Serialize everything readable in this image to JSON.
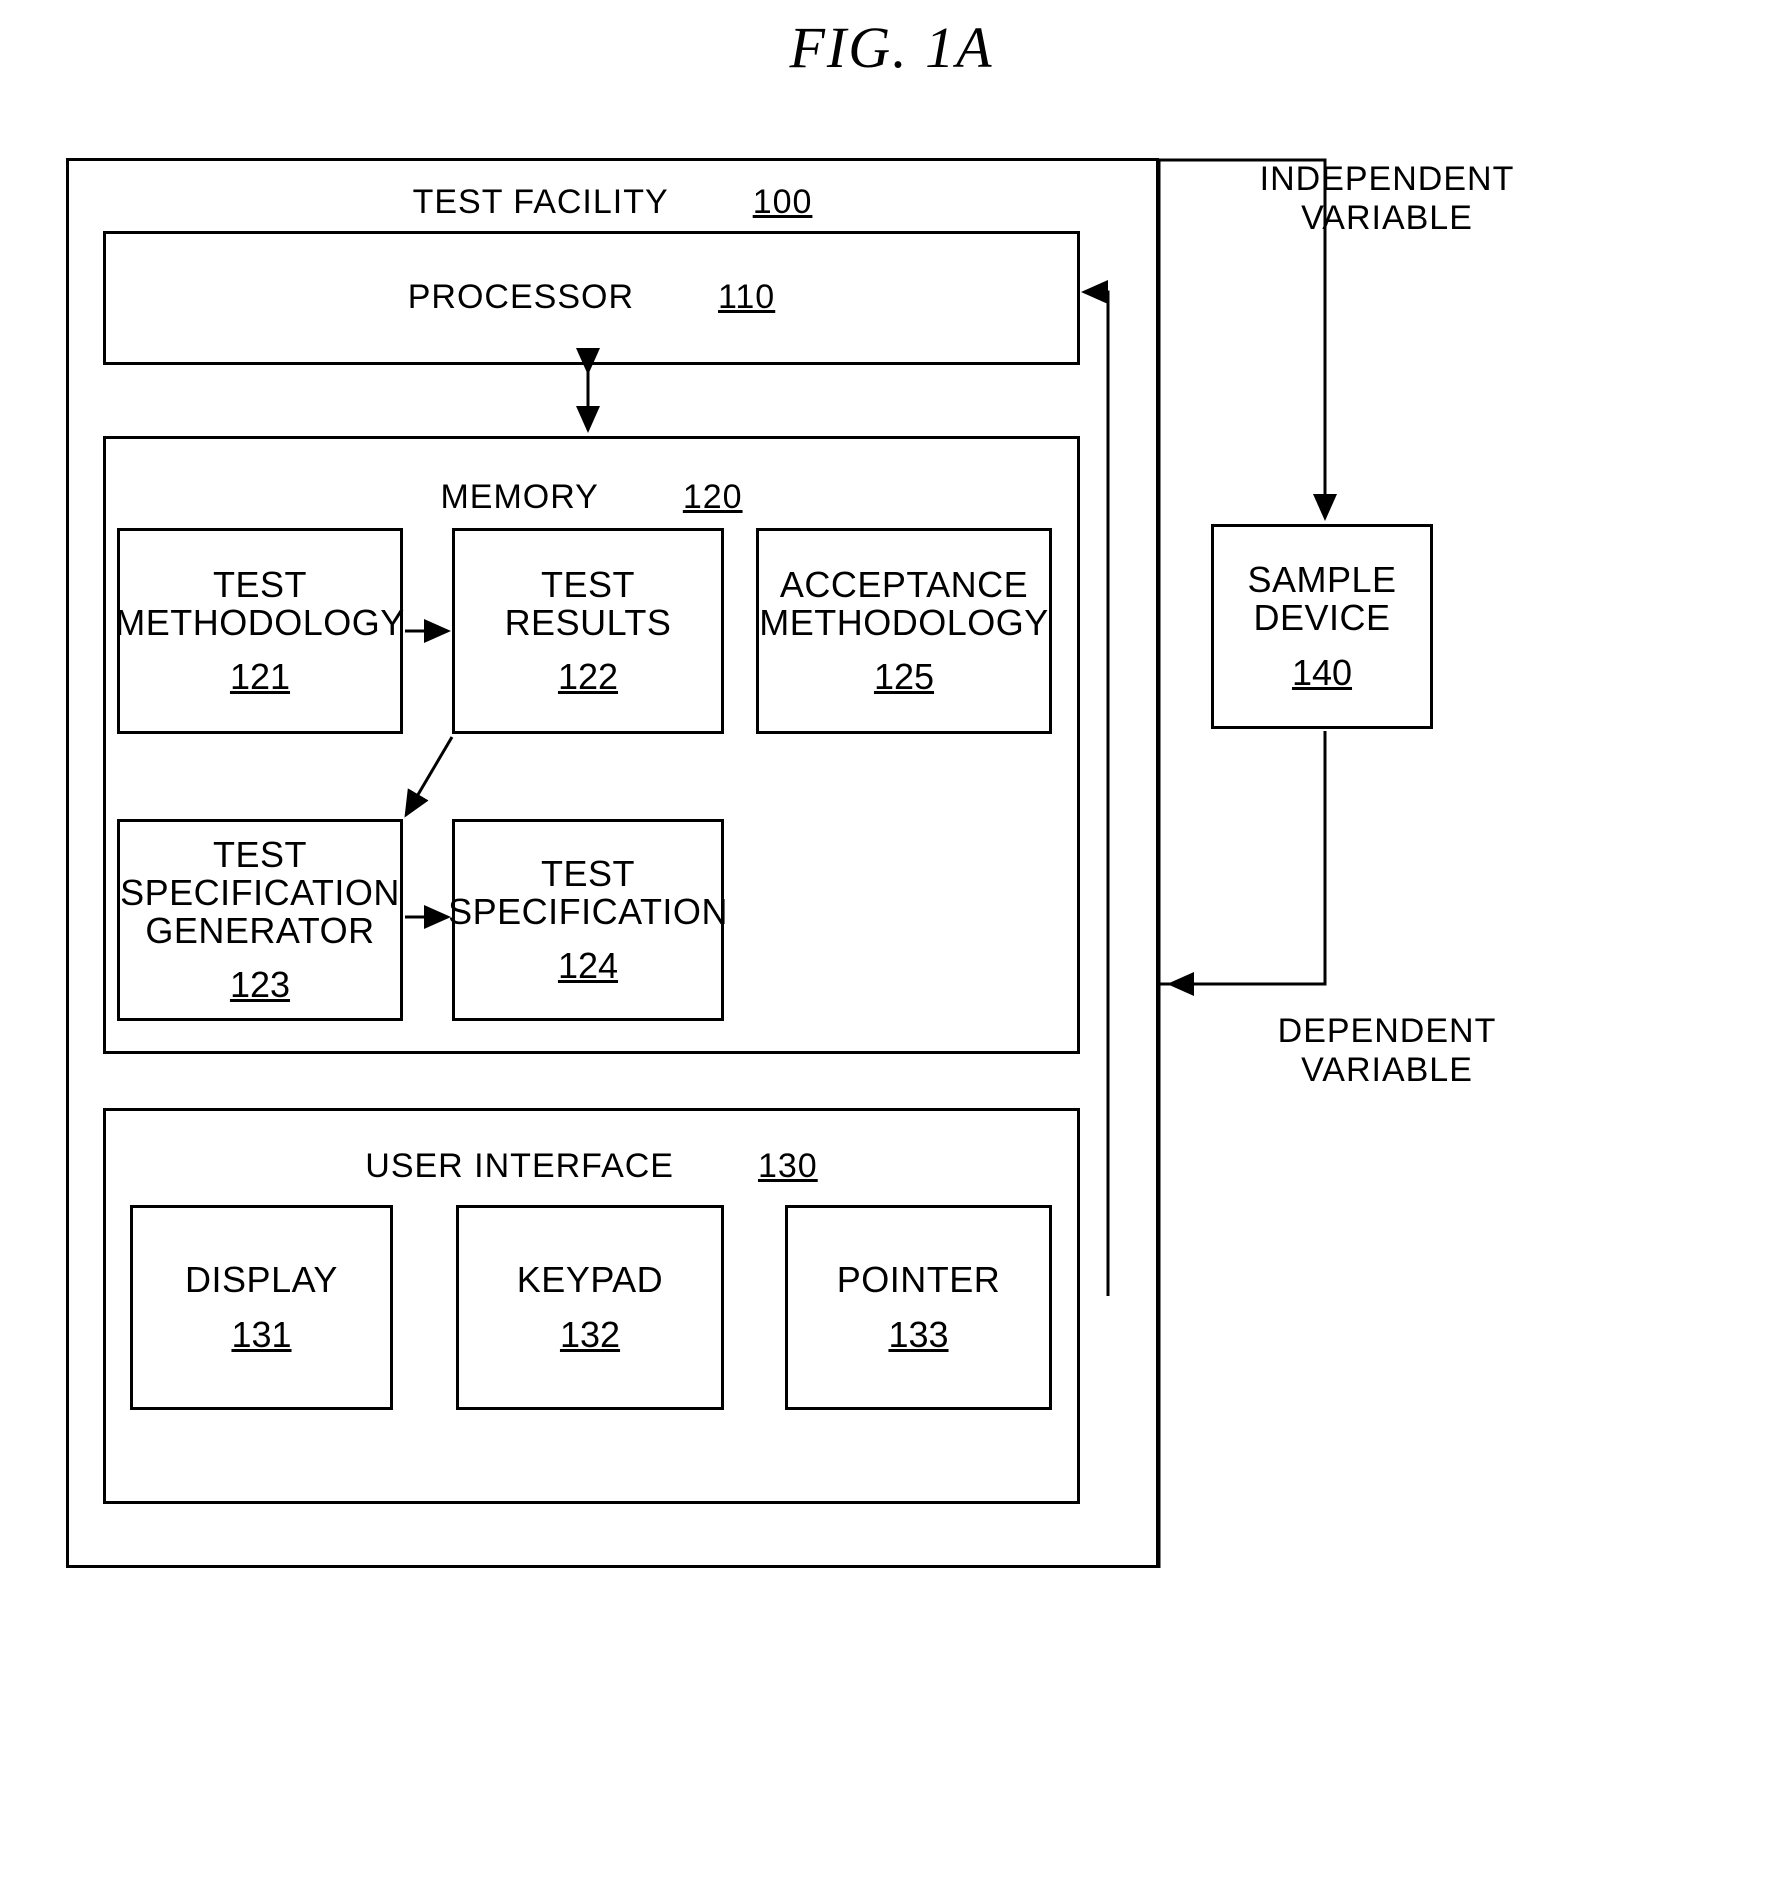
{
  "figure": {
    "title": "FIG. 1A"
  },
  "test_facility": {
    "label": "TEST FACILITY",
    "number": "100"
  },
  "processor": {
    "label": "PROCESSOR",
    "number": "110"
  },
  "memory": {
    "label": "MEMORY",
    "number": "120",
    "blocks": [
      {
        "label": "TEST\nMETHODOLOGY",
        "number": "121"
      },
      {
        "label": "TEST\nRESULTS",
        "number": "122"
      },
      {
        "label": "ACCEPTANCE\nMETHODOLOGY",
        "number": "125"
      },
      {
        "label": "TEST\nSPECIFICATION\nGENERATOR",
        "number": "123"
      },
      {
        "label": "TEST\nSPECIFICATION",
        "number": "124"
      }
    ]
  },
  "user_interface": {
    "label": "USER INTERFACE",
    "number": "130",
    "blocks": [
      {
        "label": "DISPLAY",
        "number": "131"
      },
      {
        "label": "KEYPAD",
        "number": "132"
      },
      {
        "label": "POINTER",
        "number": "133"
      }
    ]
  },
  "sample_device": {
    "label": "SAMPLE\nDEVICE",
    "number": "140"
  },
  "annotations": {
    "independent_variable": "INDEPENDENT\nVARIABLE",
    "dependent_variable": "DEPENDENT\nVARIABLE"
  },
  "colors": {
    "stroke": "#000000",
    "background": "#ffffff"
  }
}
